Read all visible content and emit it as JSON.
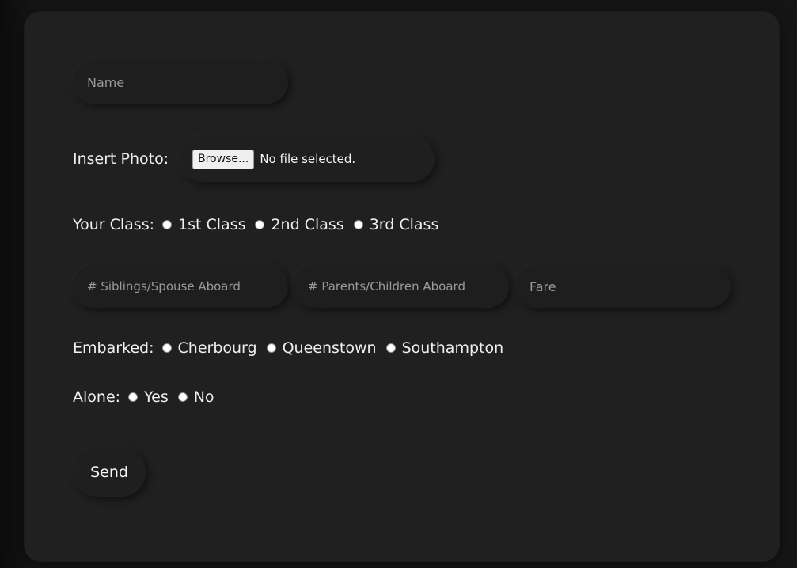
{
  "form": {
    "name_placeholder": "Name",
    "photo": {
      "label": "Insert Photo:",
      "browse_label": "Browse...",
      "status": "No file selected."
    },
    "class_group": {
      "label": "Your Class:",
      "options": [
        "1st Class",
        "2nd Class",
        "3rd Class"
      ]
    },
    "siblings_placeholder": "# Siblings/Spouse Aboard",
    "parents_placeholder": "# Parents/Children Aboard",
    "fare_placeholder": "Fare",
    "embarked_group": {
      "label": "Embarked:",
      "options": [
        "Cherbourg",
        "Queenstown",
        "Southampton"
      ]
    },
    "alone_group": {
      "label": "Alone:",
      "options": [
        "Yes",
        "No"
      ]
    },
    "send_label": "Send"
  }
}
